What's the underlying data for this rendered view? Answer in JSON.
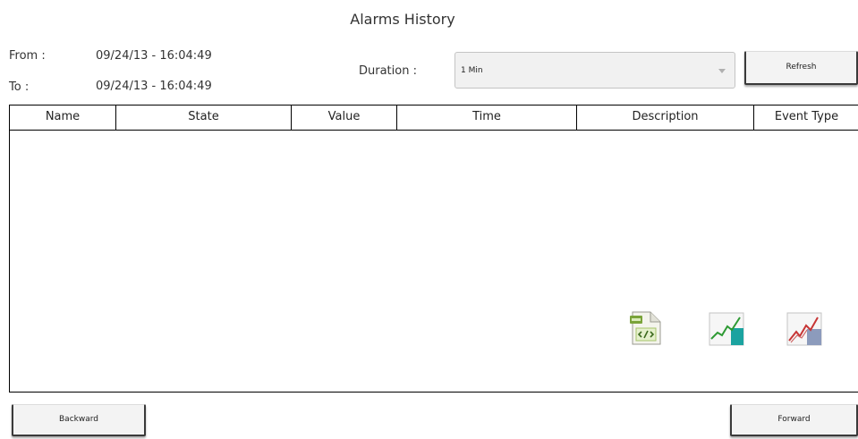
{
  "title": "Alarms History",
  "range": {
    "from_label": "From :",
    "from_value": "09/24/13 - 16:04:49",
    "to_label": "To :",
    "to_value": "09/24/13 - 16:04:49"
  },
  "duration": {
    "label": "Duration :",
    "selected": "1 Min"
  },
  "buttons": {
    "refresh": "Refresh",
    "backward": "Backward",
    "forward": "Forward"
  },
  "table": {
    "columns": [
      "Name",
      "State",
      "Value",
      "Time",
      "Description",
      "Event Type"
    ],
    "rows": []
  },
  "icons": [
    "xml-export-icon",
    "trend-chart-icon",
    "trend-chart-red-icon"
  ]
}
